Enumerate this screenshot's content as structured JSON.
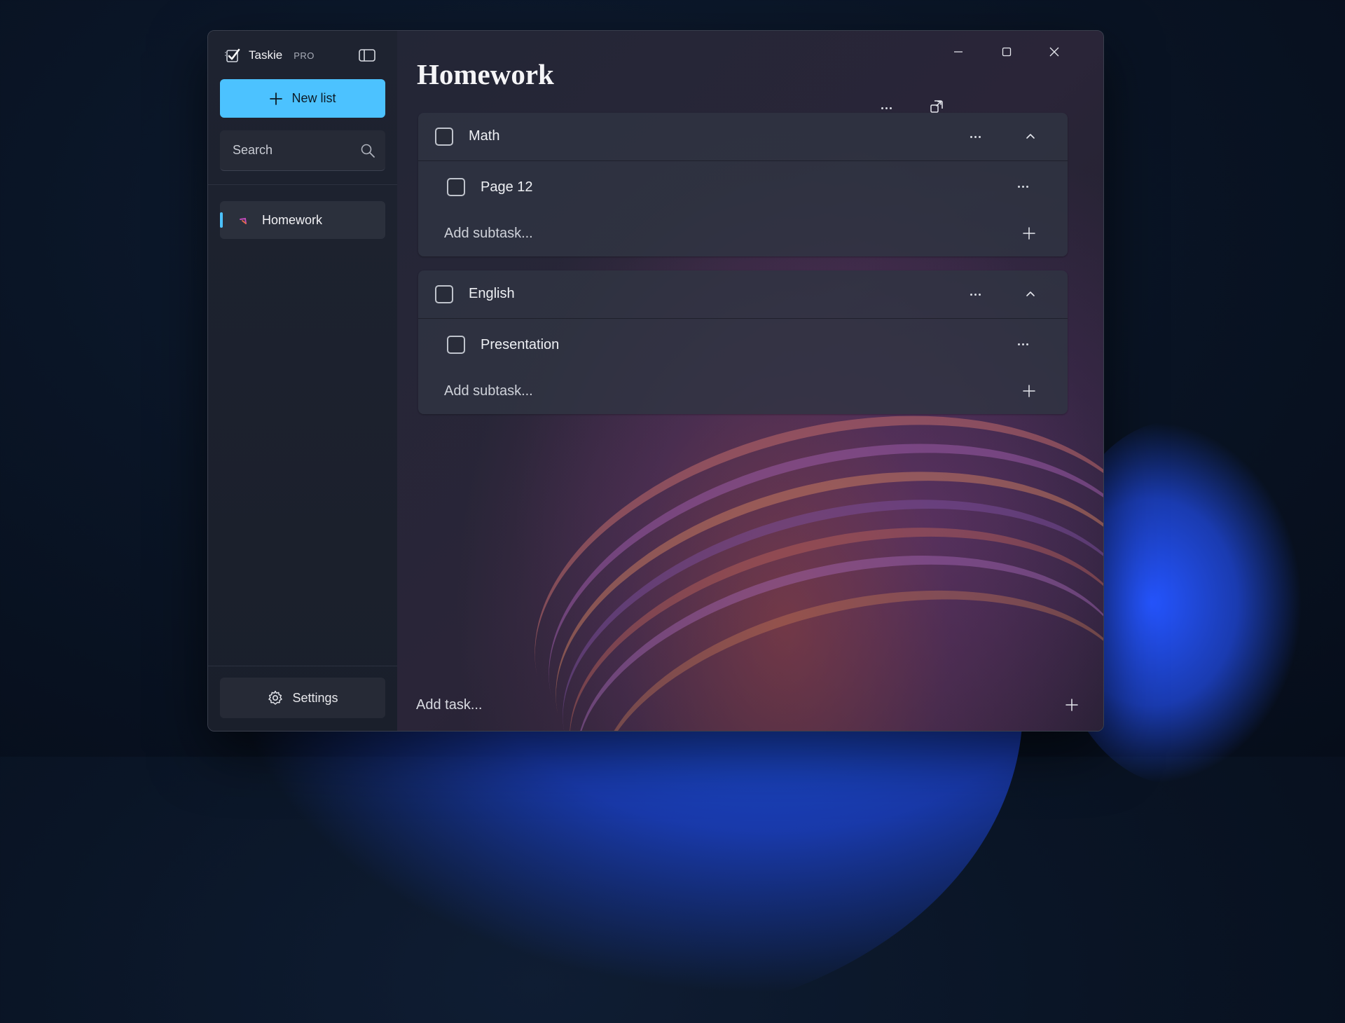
{
  "app": {
    "name": "Taskie",
    "tier": "PRO"
  },
  "sidebar": {
    "new_list_label": "New list",
    "search_placeholder": "Search",
    "lists": [
      {
        "label": "Homework",
        "selected": true
      }
    ],
    "settings_label": "Settings"
  },
  "main": {
    "title": "Homework",
    "groups": [
      {
        "title": "Math",
        "subtasks": [
          {
            "title": "Page 12"
          }
        ],
        "add_subtask_placeholder": "Add subtask..."
      },
      {
        "title": "English",
        "subtasks": [
          {
            "title": "Presentation"
          }
        ],
        "add_subtask_placeholder": "Add subtask..."
      }
    ],
    "add_task_placeholder": "Add task..."
  },
  "colors": {
    "accent": "#4cc2ff",
    "window_bg": "#1b1f2a",
    "card_bg": "#30344a"
  },
  "icons": {
    "logo": "checkmark-clipboard-icon",
    "pane_toggle": "sidebar-toggle-icon",
    "new_list": "plus-icon",
    "search": "search-icon",
    "settings": "gear-icon",
    "more": "more-dots-icon",
    "collapse": "chevron-up-icon",
    "compact_overlay": "compact-overlay-icon",
    "minimize": "minimize-icon",
    "maximize": "maximize-icon",
    "close": "close-icon"
  }
}
